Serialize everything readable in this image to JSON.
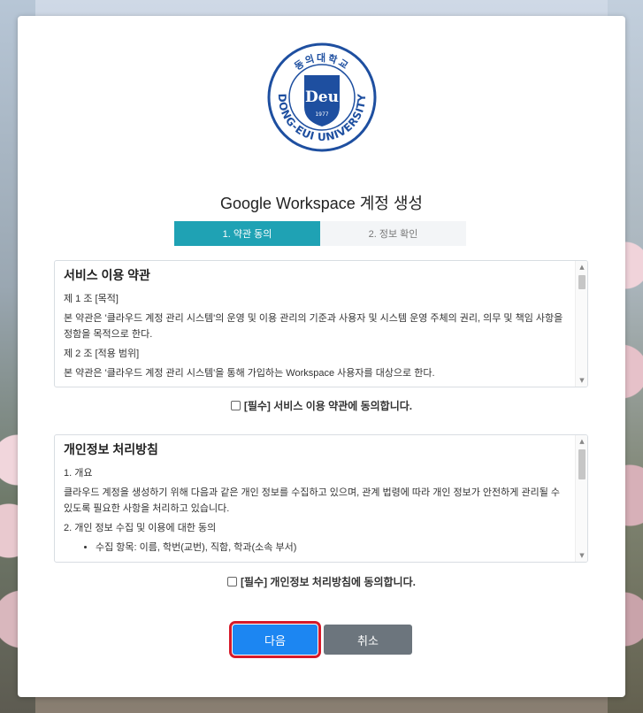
{
  "logo": {
    "top_text": "동의대학교",
    "bottom_text": "DONG-EUI UNIVERSITY",
    "emblem_text": "Deu",
    "year": "1977"
  },
  "title": "Google Workspace 계정 생성",
  "steps": [
    {
      "label": "1. 약관 동의",
      "active": true
    },
    {
      "label": "2. 정보 확인",
      "active": false
    }
  ],
  "terms": {
    "heading": "서비스 이용 약관",
    "lines": [
      "제 1 조 [목적]",
      "본 약관은 '클라우드 계정 관리 시스템'의 운영 및 이용 관리의 기준과 사용자 및 시스템 운영 주체의 권리, 의무 및 책임 사항을 정함을 목적으로 한다.",
      "제 2 조 [적용 범위]",
      "본 약관은 '클라우드 계정 관리 시스템'을 통해 가입하는 Workspace 사용자를 대상으로 한다."
    ],
    "agree_label": "[필수] 서비스 이용 약관에 동의합니다."
  },
  "privacy": {
    "heading": "개인정보 처리방침",
    "lines": [
      "1. 개요",
      "클라우드 계정을 생성하기 위해 다음과 같은 개인 정보를 수집하고 있으며, 관계 법령에 따라 개인 정보가 안전하게 관리될 수 있도록 필요한 사항을 처리하고 있습니다.",
      "2. 개인 정보 수집 및 이용에 대한 동의"
    ],
    "bullet": "수집 항목: 이름, 학번(교번), 직함, 학과(소속 부서)",
    "agree_label": "[필수] 개인정보 처리방침에 동의합니다."
  },
  "buttons": {
    "next": "다음",
    "cancel": "취소"
  },
  "colors": {
    "step_active": "#1fa2b4",
    "next_button": "#1c86f2",
    "cancel_button": "#6c757d",
    "highlight": "#d61a2a",
    "logo_blue": "#1e4fa0"
  }
}
